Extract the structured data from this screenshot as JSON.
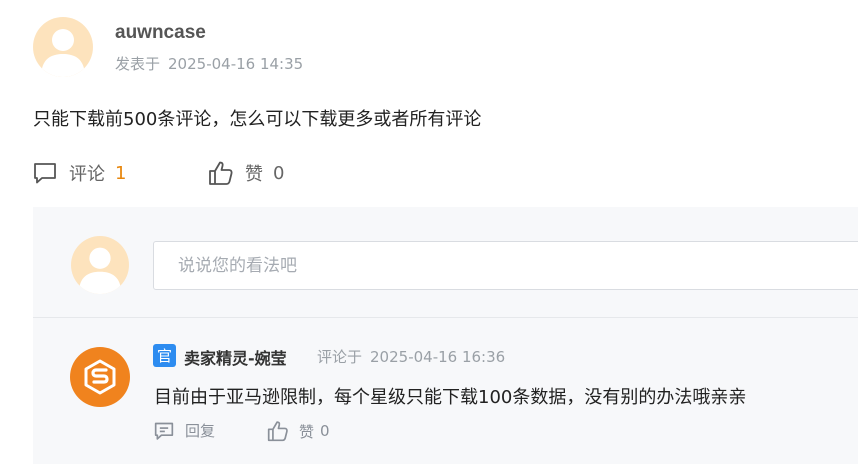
{
  "post": {
    "author": "auwncase",
    "posted_label": "发表于",
    "posted_time": "2025-04-16 14:35",
    "body": "只能下载前500条评论，怎么可以下载更多或者所有评论",
    "comment_label": "评论",
    "comment_count": "1",
    "like_label": "赞",
    "like_count": "0"
  },
  "reply_box": {
    "placeholder": "说说您的看法吧"
  },
  "reply": {
    "badge": "官",
    "author": "卖家精灵-婉莹",
    "commented_label": "评论于",
    "commented_time": "2025-04-16 16:36",
    "body": "目前由于亚马逊限制，每个星级只能下载100条数据，没有别的办法哦亲亲",
    "reply_label": "回复",
    "like_label": "赞",
    "like_count": "0"
  },
  "colors": {
    "accent_count": "#e8870e",
    "brand_orange": "#f0831e",
    "official_blue": "#2d8cf0",
    "avatar_bg": "#fde3bd"
  },
  "icons": [
    "user-avatar-icon",
    "comment-icon",
    "thumbs-up-icon",
    "brand-logo-icon"
  ]
}
